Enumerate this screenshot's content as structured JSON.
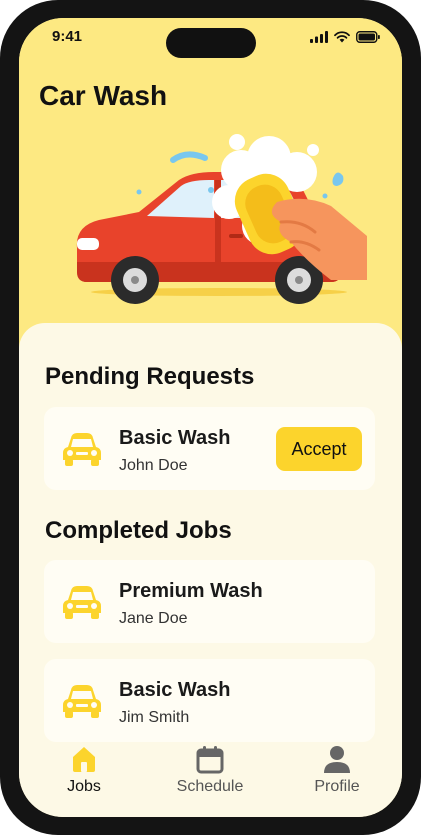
{
  "status_bar": {
    "time": "9:41"
  },
  "app": {
    "title": "Car Wash"
  },
  "pending": {
    "title": "Pending Requests",
    "items": [
      {
        "service": "Basic Wash",
        "customer": "John Doe",
        "action_label": "Accept"
      }
    ]
  },
  "completed": {
    "title": "Completed Jobs",
    "items": [
      {
        "service": "Premium Wash",
        "customer": "Jane Doe"
      },
      {
        "service": "Basic Wash",
        "customer": "Jim Smith"
      }
    ]
  },
  "tabs": [
    {
      "label": "Jobs",
      "icon": "home-icon",
      "active": true
    },
    {
      "label": "Schedule",
      "icon": "calendar-icon",
      "active": false
    },
    {
      "label": "Profile",
      "icon": "person-icon",
      "active": false
    }
  ],
  "colors": {
    "accent": "#fcd42c",
    "hero_bg": "#fde982",
    "sheet_bg": "#fdf9e6",
    "car_red": "#e8432b",
    "icon_grey": "#666666"
  }
}
